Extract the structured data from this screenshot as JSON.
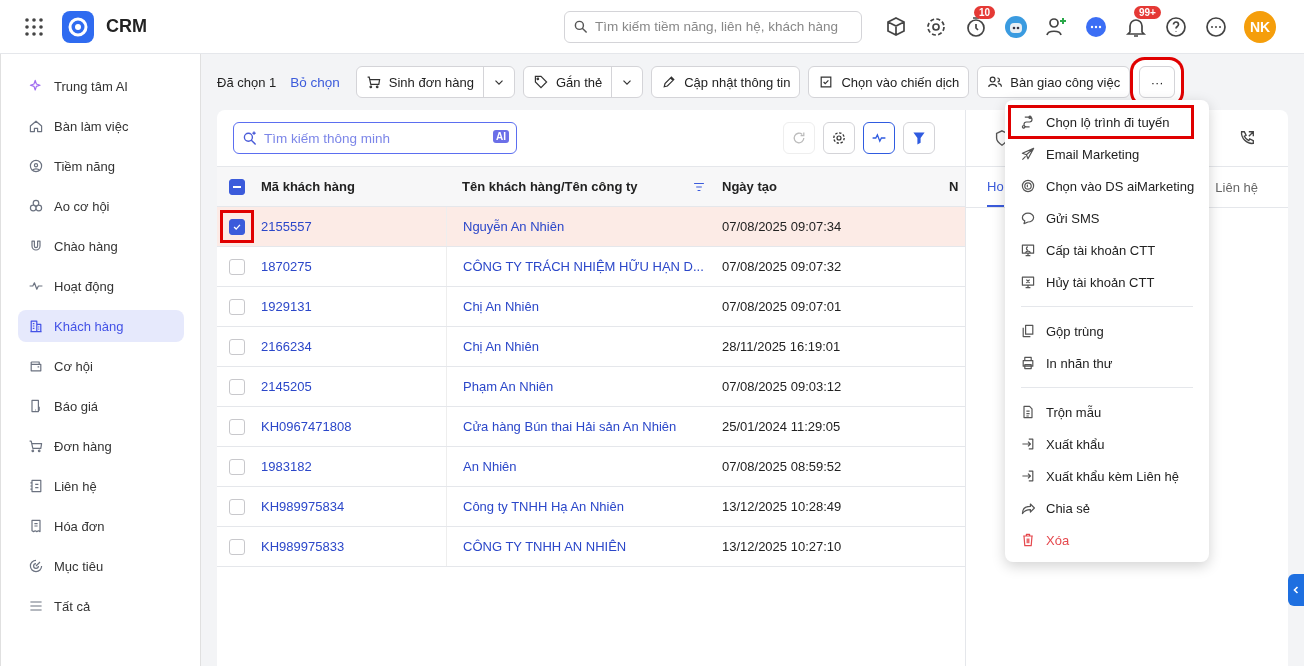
{
  "app": {
    "title": "CRM"
  },
  "header": {
    "search": {
      "placeholder": "Tìm kiếm tiềm năng, liên hệ, khách hàng"
    },
    "timer_badge": "10",
    "bell_badge": "99+",
    "avatar": "NK"
  },
  "sidebar": {
    "items": [
      {
        "label": "Trung tâm AI",
        "selected": false
      },
      {
        "label": "Bàn làm việc",
        "selected": false
      },
      {
        "label": "Tiềm năng",
        "selected": false
      },
      {
        "label": "Ao cơ hội",
        "selected": false
      },
      {
        "label": "Chào hàng",
        "selected": false
      },
      {
        "label": "Hoạt động",
        "selected": false
      },
      {
        "label": "Khách hàng",
        "selected": true
      },
      {
        "label": "Cơ hội",
        "selected": false
      },
      {
        "label": "Báo giá",
        "selected": false
      },
      {
        "label": "Đơn hàng",
        "selected": false
      },
      {
        "label": "Liên hệ",
        "selected": false
      },
      {
        "label": "Hóa đơn",
        "selected": false
      },
      {
        "label": "Mục tiêu",
        "selected": false
      },
      {
        "label": "Tất cả",
        "selected": false
      }
    ]
  },
  "toolbar": {
    "selected_count": "Đã chọn 1",
    "clear": "Bỏ chọn",
    "buttons": [
      {
        "label": "Sinh đơn hàng",
        "kind": "split"
      },
      {
        "label": "Gắn thẻ",
        "kind": "split"
      },
      {
        "label": "Cập nhật thông tin",
        "kind": "plain"
      },
      {
        "label": "Chọn vào chiến dịch",
        "kind": "plain"
      },
      {
        "label": "Bàn giao công việc",
        "kind": "plain"
      }
    ],
    "more": {
      "label": "···",
      "highlighted": true
    }
  },
  "table": {
    "search": {
      "placeholder": "Tìm kiếm thông minh",
      "badge": "AI"
    },
    "select_all": {
      "indeterminate": true
    },
    "columns": [
      "Mã khách hàng",
      "Tên khách hàng/Tên công ty",
      "Ngày tạo",
      "N"
    ],
    "rows": [
      {
        "code": "2155557",
        "name": "Nguyễn An Nhiên",
        "created": "07/08/2025 09:07:34",
        "selected": true,
        "highlighted": true
      },
      {
        "code": "1870275",
        "name": "CÔNG TY TRÁCH NHIỆM HỮU HẠN D...",
        "created": "07/08/2025 09:07:32",
        "selected": false,
        "highlighted": false
      },
      {
        "code": "1929131",
        "name": "Chị An Nhiên",
        "created": "07/08/2025 09:07:01",
        "selected": false,
        "highlighted": false
      },
      {
        "code": "2166234",
        "name": "Chị An Nhiên",
        "created": "28/11/2025 16:19:01",
        "selected": false,
        "highlighted": false
      },
      {
        "code": "2145205",
        "name": "Phạm An Nhiên",
        "created": "07/08/2025 09:03:12",
        "selected": false,
        "highlighted": false
      },
      {
        "code": "KH0967471808",
        "name": "Cửa hàng Bún thai Hải sản An Nhiên",
        "created": "25/01/2024 11:29:05",
        "selected": false,
        "highlighted": false
      },
      {
        "code": "1983182",
        "name": "An Nhiên",
        "created": "07/08/2025 08:59:52",
        "selected": false,
        "highlighted": false
      },
      {
        "code": "KH989975834",
        "name": "Công ty TNHH Hạ An Nhiên",
        "created": "13/12/2025 10:28:49",
        "selected": false,
        "highlighted": false
      },
      {
        "code": "KH989975833",
        "name": "CÔNG TY TNHH AN NHIÊN",
        "created": "13/12/2025 10:27:10",
        "selected": false,
        "highlighted": false
      }
    ]
  },
  "detail_panel": {
    "tabs": [
      {
        "label": "Ho",
        "selected": true
      },
      {
        "label": "Liên hệ",
        "selected": false
      }
    ]
  },
  "menu": {
    "items": [
      {
        "label": "Chọn lộ trình đi tuyến",
        "kind": "item",
        "highlighted": true
      },
      {
        "label": "Email Marketing",
        "kind": "item",
        "highlighted": false
      },
      {
        "label": "Chọn vào DS aiMarketing",
        "kind": "item",
        "highlighted": false
      },
      {
        "label": "Gửi SMS",
        "kind": "item",
        "highlighted": false
      },
      {
        "label": "Cấp tài khoản CTT",
        "kind": "item",
        "highlighted": false
      },
      {
        "label": "Hủy tài khoản CTT",
        "kind": "item",
        "highlighted": false
      },
      {
        "kind": "divider"
      },
      {
        "label": "Gộp trùng",
        "kind": "item",
        "highlighted": false
      },
      {
        "label": "In nhãn thư",
        "kind": "item",
        "highlighted": false
      },
      {
        "kind": "divider"
      },
      {
        "label": "Trộn mẫu",
        "kind": "item",
        "highlighted": false
      },
      {
        "label": "Xuất khẩu",
        "kind": "item",
        "highlighted": false
      },
      {
        "label": "Xuất khẩu kèm Liên hệ",
        "kind": "item",
        "highlighted": false
      },
      {
        "label": "Chia sẻ",
        "kind": "item",
        "highlighted": false
      },
      {
        "label": "Xóa",
        "kind": "danger",
        "highlighted": false
      }
    ]
  }
}
